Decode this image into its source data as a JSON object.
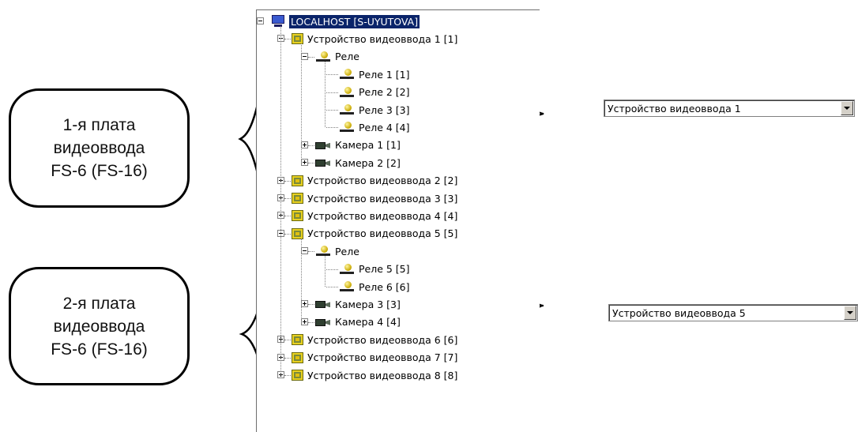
{
  "callouts": [
    {
      "lines": [
        "1-я плата",
        "видеоввода",
        "FS-6 (FS-16)"
      ]
    },
    {
      "lines": [
        "2-я плата",
        "видеоввода",
        "FS-6 (FS-16)"
      ]
    }
  ],
  "tree": {
    "root": {
      "label": "LOCALHOST [S-UYUTOVA]",
      "icon": "computer-icon"
    },
    "items": [
      {
        "label": "Устройство видеоввода 1 [1]",
        "level": 1,
        "icon": "device-icon",
        "expanded": true
      },
      {
        "label": "Реле",
        "level": 2,
        "icon": "relay-icon",
        "expanded": true
      },
      {
        "label": "Реле 1 [1]",
        "level": 3,
        "icon": "relay-icon"
      },
      {
        "label": "Реле 2 [2]",
        "level": 3,
        "icon": "relay-icon"
      },
      {
        "label": "Реле 3 [3]",
        "level": 3,
        "icon": "relay-icon"
      },
      {
        "label": "Реле 4 [4]",
        "level": 3,
        "icon": "relay-icon"
      },
      {
        "label": "Камера 1 [1]",
        "level": 2,
        "icon": "camera-icon",
        "expanded": false
      },
      {
        "label": "Камера 2 [2]",
        "level": 2,
        "icon": "camera-icon",
        "expanded": false
      },
      {
        "label": "Устройство видеоввода 2 [2]",
        "level": 1,
        "icon": "device-icon",
        "expanded": false
      },
      {
        "label": "Устройство видеоввода 3 [3]",
        "level": 1,
        "icon": "device-icon",
        "expanded": false
      },
      {
        "label": "Устройство видеоввода 4 [4]",
        "level": 1,
        "icon": "device-icon",
        "expanded": false
      },
      {
        "label": "Устройство видеоввода 5 [5]",
        "level": 1,
        "icon": "device-icon",
        "expanded": true
      },
      {
        "label": "Реле",
        "level": 2,
        "icon": "relay-icon",
        "expanded": true
      },
      {
        "label": "Реле 5 [5]",
        "level": 3,
        "icon": "relay-icon"
      },
      {
        "label": "Реле 6 [6]",
        "level": 3,
        "icon": "relay-icon"
      },
      {
        "label": "Камера 3 [3]",
        "level": 2,
        "icon": "camera-icon",
        "expanded": false
      },
      {
        "label": "Камера 4 [4]",
        "level": 2,
        "icon": "camera-icon",
        "expanded": false
      },
      {
        "label": "Устройство видеоввода 6 [6]",
        "level": 1,
        "icon": "device-icon",
        "expanded": false
      },
      {
        "label": "Устройство видеоввода 7 [7]",
        "level": 1,
        "icon": "device-icon",
        "expanded": false
      },
      {
        "label": "Устройство видеоввода 8 [8]",
        "level": 1,
        "icon": "device-icon",
        "expanded": false
      }
    ]
  },
  "dropdowns": [
    {
      "value": "Устройство видеоввода 1"
    },
    {
      "value": "Устройство видеоввода 5"
    }
  ],
  "colors": {
    "selection": "#0a246a",
    "device_icon": "#e8d020",
    "relay_icon": "#c8a800"
  }
}
